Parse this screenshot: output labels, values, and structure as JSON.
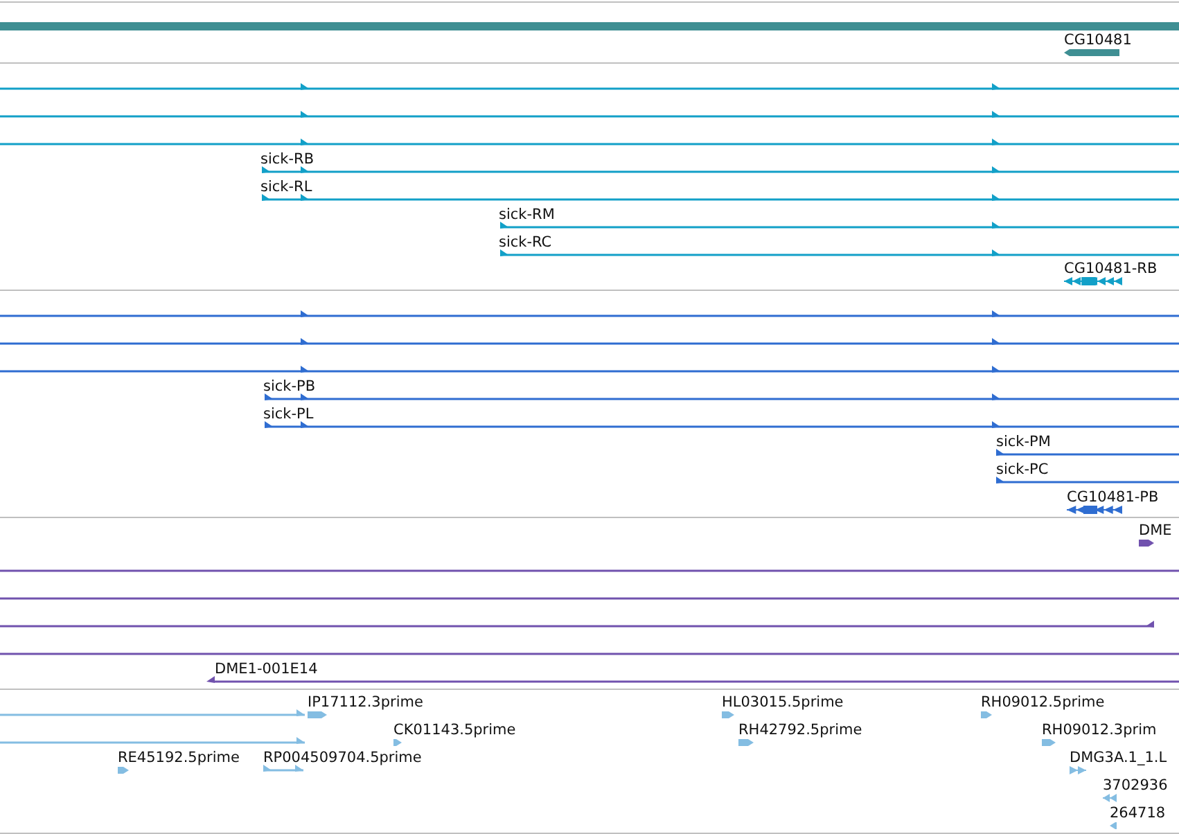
{
  "tracks": [
    {
      "color": "#3f8f93",
      "features": [
        {
          "kind": "bar"
        },
        {
          "kind": "block",
          "reverse": true,
          "label": "CG10481"
        }
      ]
    },
    {
      "color": "#12a0c8",
      "features": [
        {
          "kind": "transcript",
          "reverse": false
        },
        {
          "kind": "transcript",
          "reverse": false
        },
        {
          "kind": "transcript",
          "reverse": false
        },
        {
          "kind": "transcript",
          "reverse": false,
          "label": "sick-RB"
        },
        {
          "kind": "transcript",
          "reverse": false,
          "label": "sick-RL"
        },
        {
          "kind": "transcript",
          "reverse": false,
          "label": "sick-RM"
        },
        {
          "kind": "transcript",
          "reverse": false,
          "label": "sick-RC"
        },
        {
          "kind": "exons",
          "reverse": true,
          "label": "CG10481-RB"
        }
      ]
    },
    {
      "color": "#2f6dd1",
      "features": [
        {
          "kind": "transcript",
          "reverse": false
        },
        {
          "kind": "transcript",
          "reverse": false
        },
        {
          "kind": "transcript",
          "reverse": false
        },
        {
          "kind": "transcript",
          "reverse": false,
          "label": "sick-PB"
        },
        {
          "kind": "transcript",
          "reverse": false,
          "label": "sick-PL"
        },
        {
          "kind": "transcript",
          "reverse": false,
          "label": "sick-PM"
        },
        {
          "kind": "transcript",
          "reverse": false,
          "label": "sick-PC"
        },
        {
          "kind": "exons",
          "reverse": true,
          "label": "CG10481-PB"
        }
      ]
    },
    {
      "color": "#7152ae",
      "features": [
        {
          "kind": "block",
          "reverse": false,
          "label": "DME"
        },
        {
          "kind": "line"
        },
        {
          "kind": "line"
        },
        {
          "kind": "transcript",
          "reverse": true
        },
        {
          "kind": "line"
        },
        {
          "kind": "transcript",
          "reverse": true,
          "label": "DME1-001E14"
        }
      ]
    },
    {
      "color": "#84bde2",
      "features": [
        {
          "kind": "transcript",
          "reverse": false
        },
        {
          "kind": "block",
          "reverse": false,
          "label": "IP17112.3prime"
        },
        {
          "kind": "transcript",
          "reverse": false
        },
        {
          "kind": "block",
          "reverse": false,
          "label": "CK01143.5prime"
        },
        {
          "kind": "block",
          "reverse": false,
          "label": "RE45192.5prime"
        },
        {
          "kind": "transcript",
          "reverse": false,
          "label": "RP004509704.5prime"
        },
        {
          "kind": "block",
          "reverse": false,
          "label": "HL03015.5prime"
        },
        {
          "kind": "block",
          "reverse": false,
          "label": "RH42792.5prime"
        },
        {
          "kind": "block",
          "reverse": false,
          "label": "RH09012.5prime"
        },
        {
          "kind": "block",
          "reverse": false,
          "label": "RH09012.3prim"
        },
        {
          "kind": "exons",
          "reverse": false,
          "label": "DMG3A.1_1.L"
        },
        {
          "kind": "exons",
          "reverse": true,
          "label": "3702936"
        },
        {
          "kind": "block",
          "reverse": true,
          "label": "264718"
        }
      ]
    }
  ]
}
